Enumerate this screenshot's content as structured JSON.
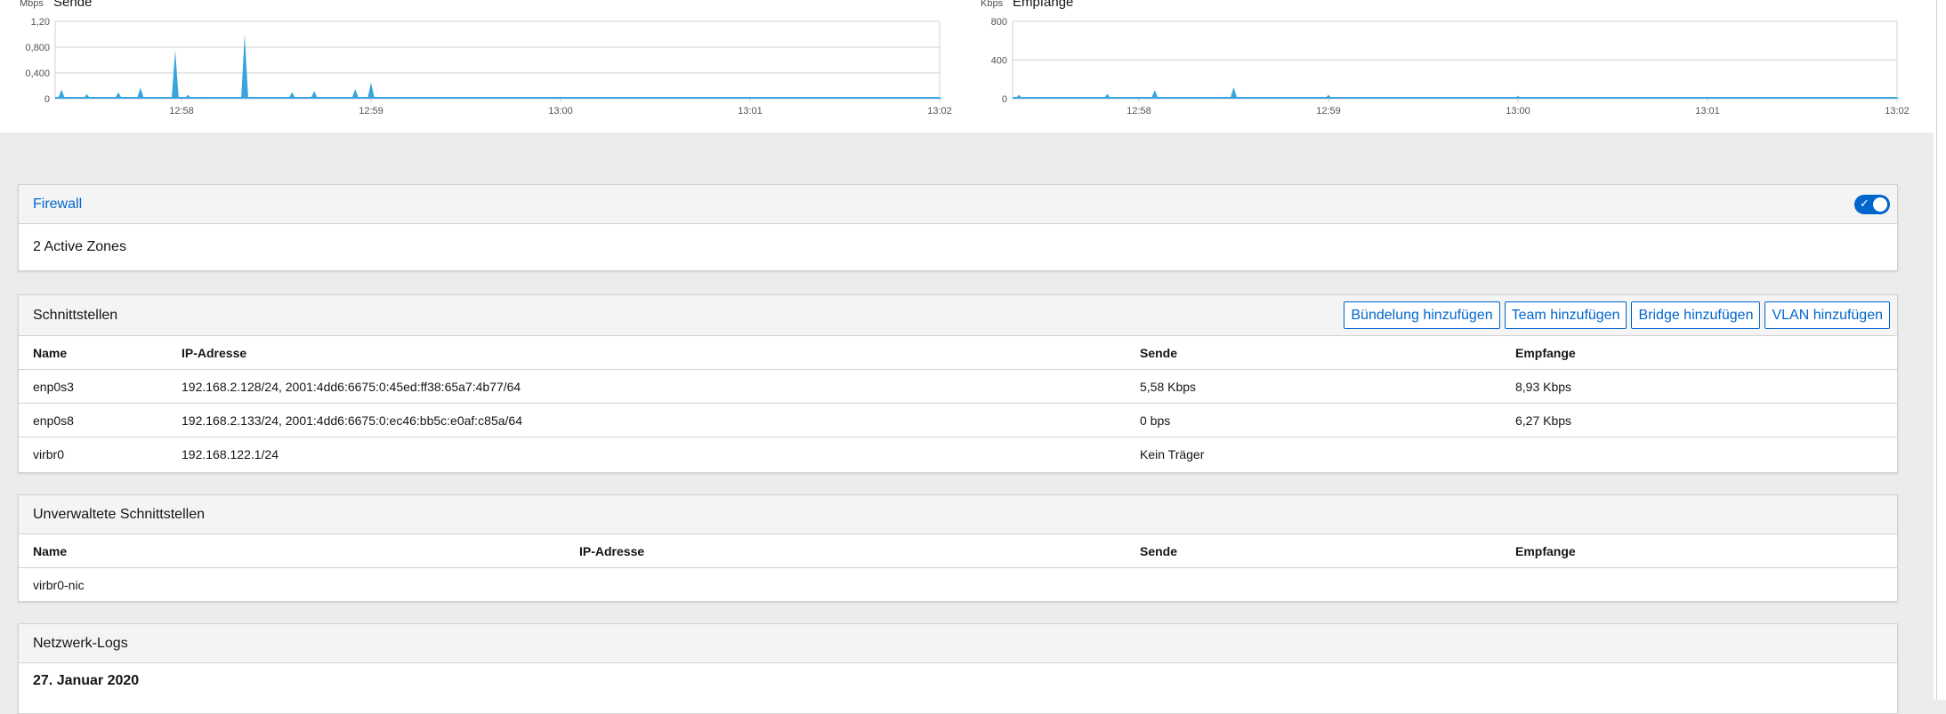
{
  "charts": {
    "send": {
      "title": "Sende",
      "unit": "Mbps",
      "y_ticks": [
        "1,20",
        "0,800",
        "0,400",
        "0"
      ],
      "x_ticks": [
        "12:58",
        "12:59",
        "13:00",
        "13:01",
        "13:02"
      ]
    },
    "receive": {
      "title": "Empfange",
      "unit": "Kbps",
      "y_ticks": [
        "800",
        "400",
        "0"
      ],
      "x_ticks": [
        "12:58",
        "12:59",
        "13:00",
        "13:01",
        "13:02"
      ]
    }
  },
  "chart_data": [
    {
      "type": "area",
      "title": "Sende",
      "ylabel": "Mbps",
      "ylim": [
        0,
        1.2
      ],
      "x": [
        "12:57:22",
        "12:57:30",
        "12:57:40",
        "12:57:47",
        "12:57:58",
        "12:58:02",
        "12:58:07",
        "12:58:20",
        "12:58:35",
        "12:58:42",
        "12:58:55",
        "12:59:00",
        "13:00:00",
        "13:01:00",
        "13:02:00"
      ],
      "series": [
        {
          "values": [
            0.14,
            0.07,
            0.1,
            0.17,
            0.75,
            0.06,
            0.03,
            1.0,
            0.1,
            0.12,
            0.15,
            0.25,
            0.02,
            0.02,
            0.02
          ]
        }
      ]
    },
    {
      "type": "area",
      "title": "Empfange",
      "ylabel": "Kbps",
      "ylim": [
        0,
        800
      ],
      "x": [
        "12:57:22",
        "12:57:50",
        "12:58:05",
        "12:58:30",
        "12:59:00",
        "13:00:00",
        "13:01:00",
        "13:02:00"
      ],
      "series": [
        {
          "values": [
            40,
            50,
            90,
            120,
            40,
            30,
            20,
            10
          ]
        }
      ]
    }
  ],
  "firewall": {
    "title": "Firewall",
    "enabled": true,
    "active_zones": "2 Active Zones"
  },
  "interfaces": {
    "title": "Schnittstellen",
    "buttons": [
      "Bündelung hinzufügen",
      "Team hinzufügen",
      "Bridge hinzufügen",
      "VLAN hinzufügen"
    ],
    "columns": [
      "Name",
      "IP-Adresse",
      "Sende",
      "Empfange"
    ],
    "rows": [
      [
        "enp0s3",
        "192.168.2.128/24, 2001:4dd6:6675:0:45ed:ff38:65a7:4b77/64",
        "5,58 Kbps",
        "8,93 Kbps"
      ],
      [
        "enp0s8",
        "192.168.2.133/24, 2001:4dd6:6675:0:ec46:bb5c:e0af:c85a/64",
        "0 bps",
        "6,27 Kbps"
      ],
      [
        "virbr0",
        "192.168.122.1/24",
        "Kein Träger",
        ""
      ]
    ]
  },
  "unmanaged": {
    "title": "Unverwaltete Schnittstellen",
    "columns": [
      "Name",
      "IP-Adresse",
      "Sende",
      "Empfange"
    ],
    "rows": [
      [
        "virbr0-nic",
        "",
        "",
        ""
      ]
    ]
  },
  "logs": {
    "title": "Netzwerk-Logs",
    "date": "27. Januar 2020"
  },
  "colors": {
    "accent": "#0066cc",
    "chart_fill": "#39a5dc"
  }
}
